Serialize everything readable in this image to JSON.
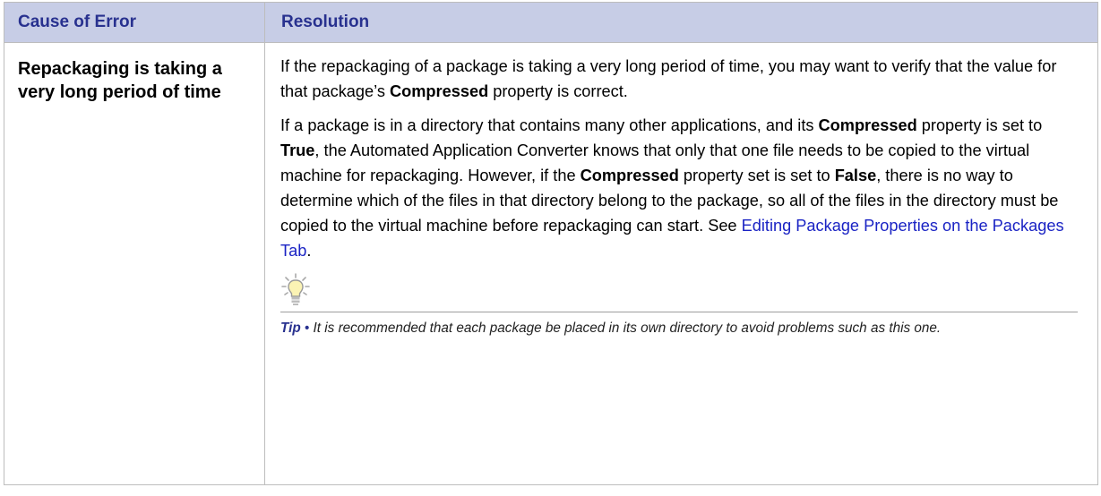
{
  "table": {
    "header": {
      "cause": "Cause of Error",
      "resolution": "Resolution"
    },
    "row": {
      "cause": "Repackaging is taking a very long period of time",
      "para1": {
        "a": "If the repackaging of a package is taking a very long period of time, you may want to verify that the value for that package’s ",
        "b": "Compressed",
        "c": " property is correct."
      },
      "para2": {
        "a": "If a package is in a directory that contains many other applications, and its ",
        "b": "Compressed",
        "c": " property is set to ",
        "d": "True",
        "e": ", the Automated Application Converter knows that only that one file needs to be copied to the virtual machine for repackaging. However, if the ",
        "f": "Compressed",
        "g": " property set is set to ",
        "h": "False",
        "i": ", there is no way to determine which of the files in that directory belong to the package, so all of the files in the directory must be copied to the virtual machine before repackaging can start. See ",
        "link": "Editing Package Properties on the Packages Tab",
        "j": "."
      },
      "tip": {
        "icon": "lightbulb-icon",
        "label": "Tip",
        "bullet": " • ",
        "text": "It is recommended that each package be placed in its own directory to avoid problems such as this one."
      }
    }
  },
  "colors": {
    "header_bg": "#c7cde6",
    "header_text": "#28318f",
    "link": "#1a23c4",
    "border": "#bdbdbd"
  }
}
